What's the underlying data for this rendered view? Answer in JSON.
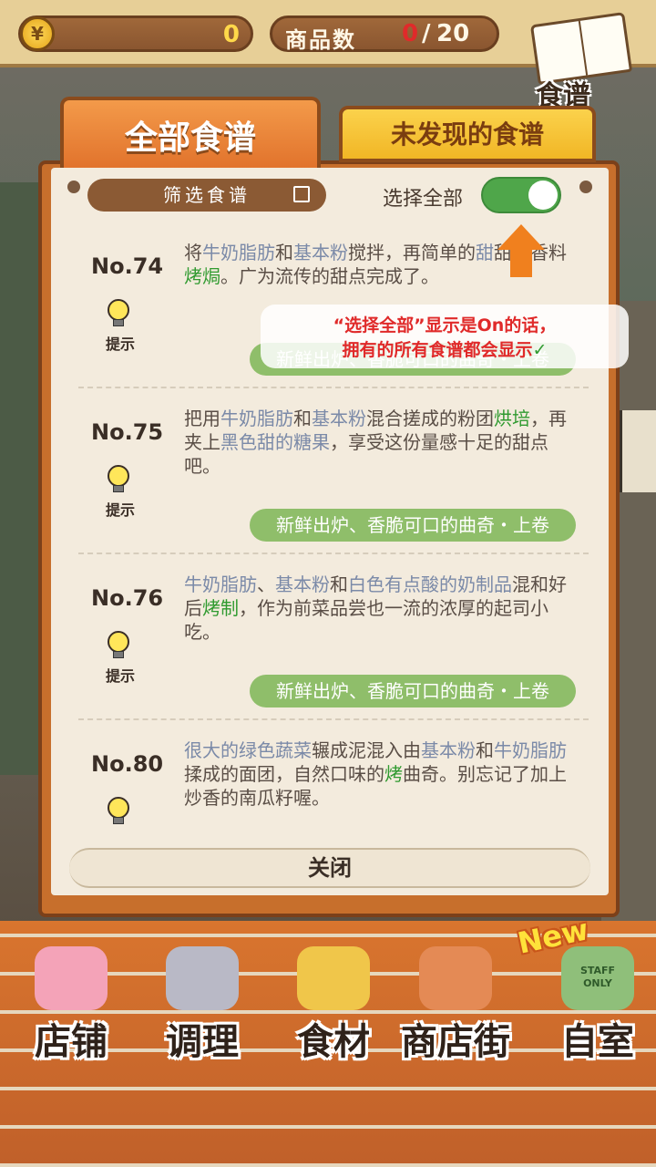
{
  "topbar": {
    "coin_symbol": "¥",
    "coins": "0",
    "goods_label": "商品数",
    "goods_count": "0",
    "goods_separator": "/",
    "goods_max": "20",
    "recipe_book_label": "食谱"
  },
  "tabs": {
    "all": "全部食谱",
    "undiscovered": "未发现的食谱"
  },
  "panel": {
    "filter_label": "筛选食谱",
    "select_all_label": "选择全部",
    "select_all_on": true,
    "close_label": "关闭"
  },
  "tooltip": {
    "line1": "“选择全部”显示是On的话，",
    "line2": "拥有的所有食谱都会显示",
    "check": "✓"
  },
  "recipes": [
    {
      "no": "No.74",
      "hint": "提示",
      "parts": [
        {
          "t": "将",
          "k": ""
        },
        {
          "t": "牛奶脂肪",
          "k": "ing"
        },
        {
          "t": "和",
          "k": ""
        },
        {
          "t": "基本粉",
          "k": "ing"
        },
        {
          "t": "搅拌，再简单",
          "k": ""
        },
        {
          "t": "的",
          "k": ""
        },
        {
          "t": "甜",
          "k": "ing"
        },
        {
          "t": "甜的香料",
          "k": ""
        },
        {
          "t": "烤焗",
          "k": "act"
        },
        {
          "t": "。广为流传的甜点完成了。",
          "k": ""
        }
      ],
      "collection": "新鲜出炉、香脆可口的曲奇・上卷"
    },
    {
      "no": "No.75",
      "hint": "提示",
      "parts": [
        {
          "t": "把用",
          "k": ""
        },
        {
          "t": "牛奶脂肪",
          "k": "ing"
        },
        {
          "t": "和",
          "k": ""
        },
        {
          "t": "基本粉",
          "k": "ing"
        },
        {
          "t": "混合搓成的粉团",
          "k": ""
        },
        {
          "t": "烘培",
          "k": "act"
        },
        {
          "t": "，再夹上",
          "k": ""
        },
        {
          "t": "黑色甜的糖果",
          "k": "ing"
        },
        {
          "t": "，享受这份量感十足的甜点吧。",
          "k": ""
        }
      ],
      "collection": "新鲜出炉、香脆可口的曲奇・上卷"
    },
    {
      "no": "No.76",
      "hint": "提示",
      "parts": [
        {
          "t": "牛奶脂肪",
          "k": "ing"
        },
        {
          "t": "、",
          "k": ""
        },
        {
          "t": "基本粉",
          "k": "ing"
        },
        {
          "t": "和",
          "k": ""
        },
        {
          "t": "白色有点酸的奶制品",
          "k": "ing"
        },
        {
          "t": "混和好后",
          "k": ""
        },
        {
          "t": "烤制",
          "k": "act"
        },
        {
          "t": "，作为前菜品尝也一流的浓厚的起司小吃。",
          "k": ""
        }
      ],
      "collection": "新鲜出炉、香脆可口的曲奇・上卷"
    },
    {
      "no": "No.80",
      "hint": "",
      "parts": [
        {
          "t": "很大的绿色蔬菜",
          "k": "ing"
        },
        {
          "t": "辗成泥混入由",
          "k": ""
        },
        {
          "t": "基本粉",
          "k": "ing"
        },
        {
          "t": "和",
          "k": ""
        },
        {
          "t": "牛奶脂肪",
          "k": "ing"
        },
        {
          "t": "揉成的面团，自然口味的",
          "k": ""
        },
        {
          "t": "烤",
          "k": "act"
        },
        {
          "t": "曲奇。别忘记了加上炒香的南瓜籽喔。",
          "k": ""
        }
      ],
      "collection": ""
    }
  ],
  "nav": {
    "new_badge": "New",
    "items": [
      {
        "label": "店铺",
        "icon": "cake-icon",
        "color": "#f4a3b8"
      },
      {
        "label": "调理",
        "icon": "mixing-bowl-icon",
        "color": "#b9b9c6"
      },
      {
        "label": "食材",
        "icon": "flour-bag-icon",
        "color": "#f0c64a"
      },
      {
        "label": "商店街",
        "icon": "storefront-icon",
        "color": "#e48a55"
      },
      {
        "label": "自室",
        "icon": "staff-only-door-icon",
        "color": "#8fbf7a"
      }
    ],
    "staff_sign": "STAFF ONLY"
  }
}
